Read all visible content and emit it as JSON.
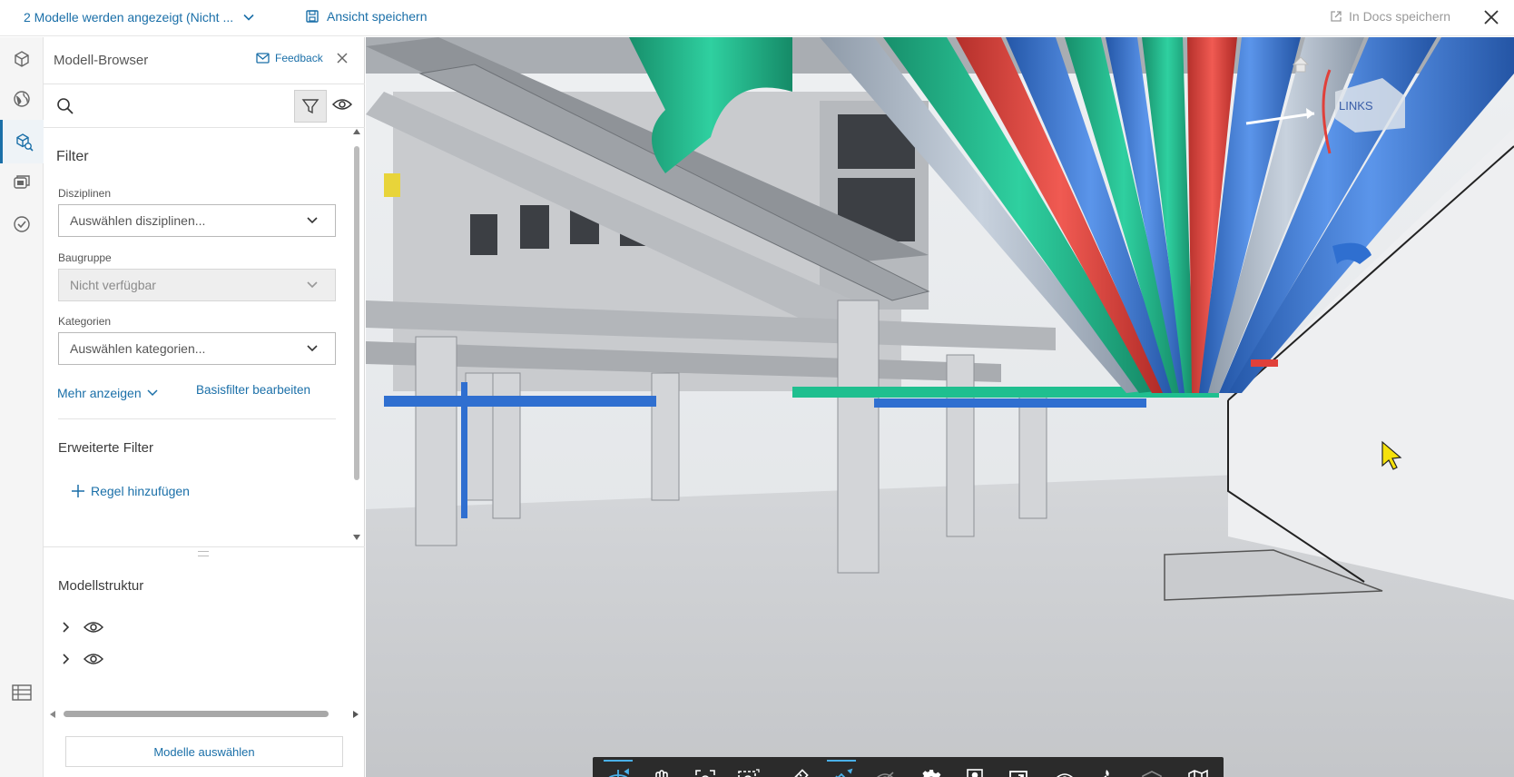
{
  "topbar": {
    "models_label": "2 Modelle werden angezeigt (Nicht ...",
    "save_view_label": "Ansicht speichern",
    "save_docs_label": "In Docs speichern"
  },
  "rail": {
    "items": [
      "cube-icon",
      "globe-icon",
      "model-browser-icon",
      "sheets-icon",
      "issues-icon",
      "table-icon"
    ]
  },
  "panel": {
    "title": "Modell-Browser",
    "feedback_label": "Feedback",
    "filter": {
      "title": "Filter",
      "disciplines_label": "Disziplinen",
      "disciplines_value": "Auswählen disziplinen...",
      "assembly_label": "Baugruppe",
      "assembly_value": "Nicht verfügbar",
      "categories_label": "Kategorien",
      "categories_value": "Auswählen kategorien...",
      "more_label": "Mehr anzeigen",
      "edit_basic_label": "Basisfilter bearbeiten",
      "advanced_title": "Erweiterte Filter",
      "add_rule_label": "Regel hinzufügen"
    },
    "structure": {
      "title": "Modellstruktur",
      "rows": [
        "",
        ""
      ]
    },
    "select_models_label": "Modelle auswählen"
  },
  "viewcube": {
    "label": "LINKS"
  },
  "toolbar": {
    "groups": [
      [
        "orbit-icon",
        "pan-icon",
        "fit-view-icon",
        "zoom-window-icon",
        "first-person-icon"
      ],
      [
        "measure-icon",
        "section-icon",
        "visibility-icon"
      ],
      [
        "settings-icon",
        "properties-icon",
        "fullscreen-icon"
      ],
      [
        "ghost-icon",
        "explode-icon",
        "model-visibility-icon"
      ],
      [
        "map-icon"
      ]
    ]
  },
  "colors": {
    "accent": "#1a6fa8",
    "toolbar_bg": "#2b2b2b",
    "toolbar_active": "#4ab0e8",
    "pipe_green": "#1fbf8f",
    "pipe_red": "#e0403a",
    "pipe_blue": "#2f6fd0"
  }
}
